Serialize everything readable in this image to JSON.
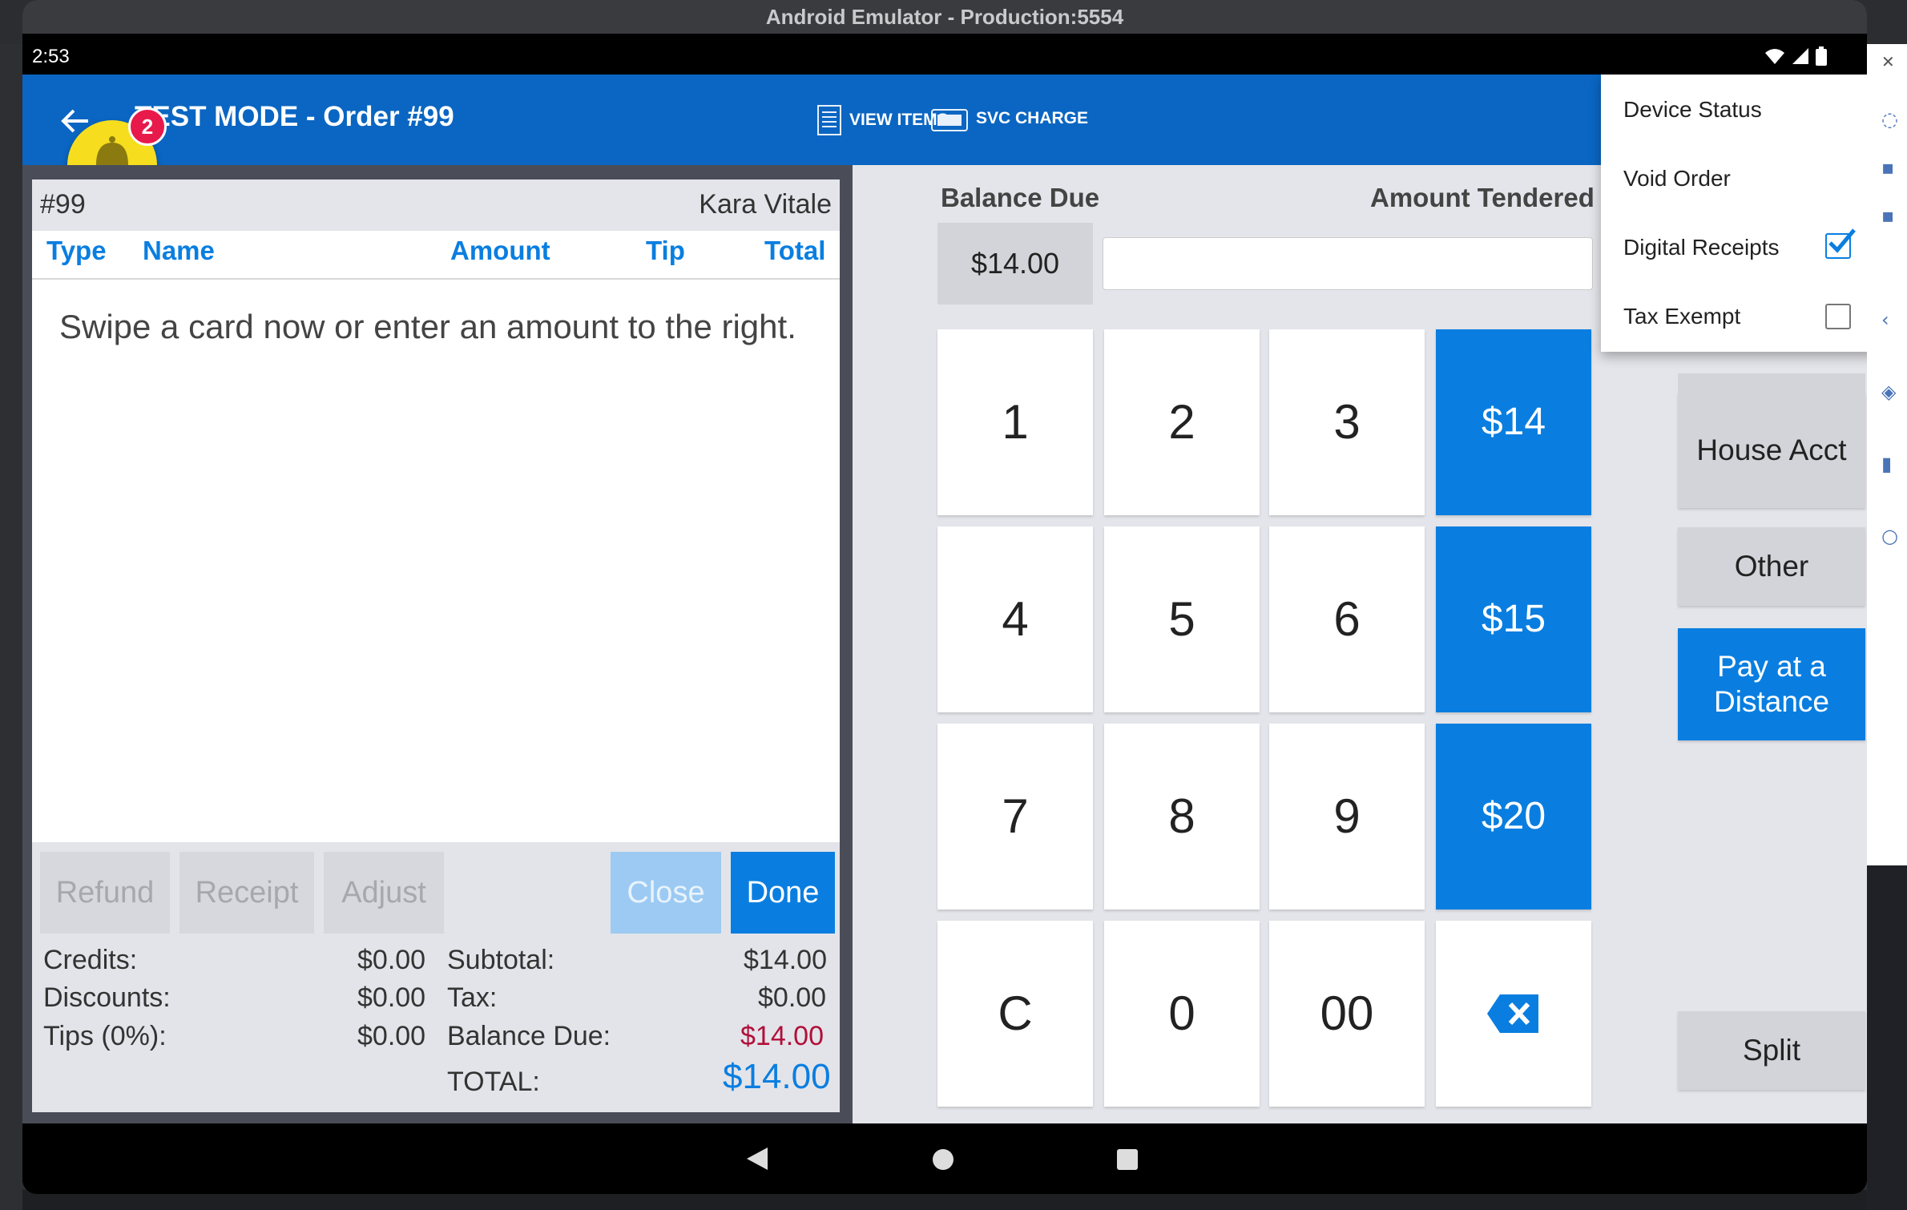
{
  "window": {
    "title": "Android Emulator - Production:5554"
  },
  "status_bar": {
    "time": "2:53"
  },
  "app_bar": {
    "title": "TEST MODE - Order #99",
    "view_items": "VIEW ITEMS",
    "svc_charge": "SVC CHARGE"
  },
  "notification": {
    "count": "2"
  },
  "order": {
    "number": "#99",
    "customer": "Kara Vitale",
    "columns": [
      "Type",
      "Name",
      "Amount",
      "Tip",
      "Total"
    ],
    "prompt": "Swipe a card now or enter an amount to the right."
  },
  "actions": {
    "refund": "Refund",
    "receipt": "Receipt",
    "adjust": "Adjust",
    "close": "Close",
    "done": "Done"
  },
  "summary": {
    "credits_label": "Credits:",
    "credits": "$0.00",
    "discounts_label": "Discounts:",
    "discounts": "$0.00",
    "tips_label": "Tips (0%):",
    "tips": "$0.00",
    "subtotal_label": "Subtotal:",
    "subtotal": "$14.00",
    "tax_label": "Tax:",
    "tax": "$0.00",
    "balance_label": "Balance Due:",
    "balance": "$14.00",
    "total_label": "TOTAL:",
    "total": "$14.00"
  },
  "payment": {
    "balance_due_label": "Balance Due",
    "amount_tendered_label": "Amount Tendered",
    "balance_due": "$14.00",
    "amount_tendered": ""
  },
  "keypad": {
    "k1": "1",
    "k2": "2",
    "k3": "3",
    "k4": "4",
    "k5": "5",
    "k6": "6",
    "k7": "7",
    "k8": "8",
    "k9": "9",
    "kc": "C",
    "k0": "0",
    "k00": "00",
    "q1": "$14",
    "q2": "$15",
    "q3": "$20"
  },
  "side_buttons": {
    "house_acct": "House Acct",
    "other": "Other",
    "pay_distance": "Pay at a Distance",
    "split": "Split"
  },
  "menu": {
    "device_status": "Device Status",
    "void_order": "Void Order",
    "digital_receipts": "Digital Receipts",
    "digital_receipts_checked": true,
    "tax_exempt": "Tax Exempt",
    "tax_exempt_checked": false
  },
  "colors": {
    "app_bar": "#0a66c2",
    "accent": "#0a7ee0",
    "balance_due": "#b0103a",
    "bell": "#f6dd1e",
    "badge": "#e8194b"
  }
}
